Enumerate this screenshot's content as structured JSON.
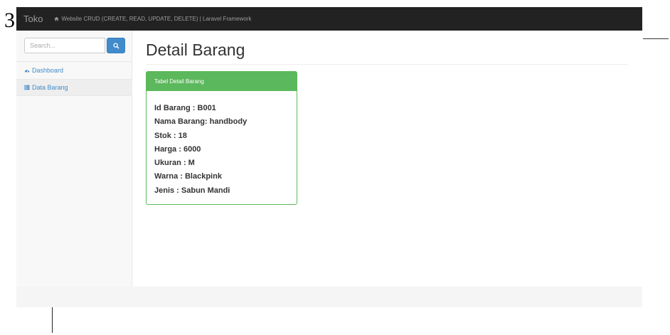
{
  "page_number": "3",
  "navbar": {
    "brand": "Toko",
    "subtitle": "Website CRUD (CREATE, READ, UPDATE, DELETE) | Laravel Framework",
    "home_icon": "home-icon"
  },
  "sidebar": {
    "search": {
      "placeholder": "Search..."
    },
    "items": [
      {
        "label": "Dashboard",
        "icon": "dashboard-icon"
      },
      {
        "label": "Data Barang",
        "icon": "table-icon"
      }
    ]
  },
  "main": {
    "title": "Detail Barang",
    "panel": {
      "heading": "Tabel Detail Barang",
      "lines": [
        "Id Barang : B001",
        "Nama Barang: handbody",
        "Stok : 18",
        "Harga : 6000",
        "Ukuran : M",
        "Warna : Blackpink",
        "Jenis : Sabun Mandi"
      ]
    }
  },
  "colors": {
    "navbar": "#222222",
    "accent_blue": "#428bca",
    "panel_green": "#5cb85c"
  }
}
